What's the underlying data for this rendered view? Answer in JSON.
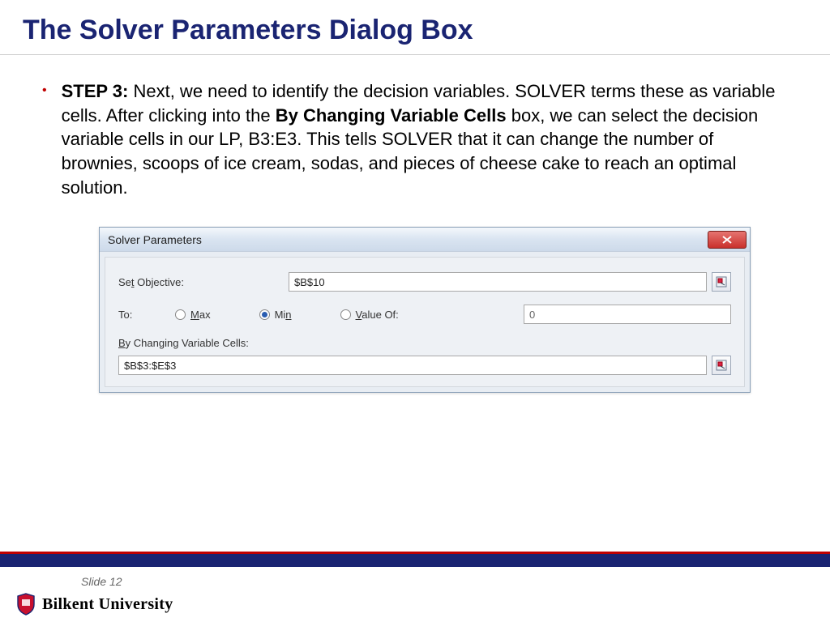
{
  "title": "The Solver Parameters Dialog Box",
  "bullet": {
    "step": "STEP 3:",
    "t1": " Next, we need to identify the decision variables. SOLVER terms these as variable cells. After clicking into the ",
    "bold": "By Changing Variable Cells",
    "t2": " box, we can select the decision variable cells in our LP, B3:E3. This tells SOLVER that it can change the number of brownies, scoops of ice cream, sodas, and pieces of cheese cake to reach an optimal solution."
  },
  "dialog": {
    "title": "Solver Parameters",
    "set_objective_label": "Set Objective:",
    "set_objective_value": "$B$10",
    "to_label": "To:",
    "radio_max": "Max",
    "radio_min": "Min",
    "radio_valueof": "Value Of:",
    "valueof_value": "0",
    "by_changing_label": "By Changing Variable Cells:",
    "by_changing_value": "$B$3:$E$3"
  },
  "footer": {
    "slide": "Slide 12",
    "university": "Bilkent University"
  }
}
